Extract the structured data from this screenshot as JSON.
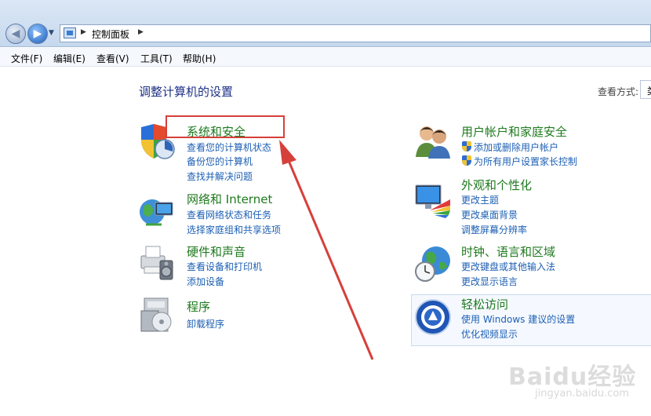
{
  "address_bar": {
    "breadcrumb": "控制面板",
    "icon": "control-panel-icon"
  },
  "menu": [
    "文件(F)",
    "编辑(E)",
    "查看(V)",
    "工具(T)",
    "帮助(H)"
  ],
  "page_title": "调整计算机的设置",
  "view_by": {
    "label": "查看方式:",
    "value": "类"
  },
  "categories": [
    {
      "title": "系统和安全",
      "icon": "security-shield-icon",
      "links": [
        "查看您的计算机状态",
        "备份您的计算机",
        "查找并解决问题"
      ]
    },
    {
      "title": "网络和 Internet",
      "icon": "network-globe-icon",
      "links": [
        "查看网络状态和任务",
        "选择家庭组和共享选项"
      ]
    },
    {
      "title": "硬件和声音",
      "icon": "printer-speaker-icon",
      "links": [
        "查看设备和打印机",
        "添加设备"
      ]
    },
    {
      "title": "程序",
      "icon": "programs-icon",
      "links": [
        "卸载程序"
      ]
    },
    {
      "title": "用户帐户和家庭安全",
      "icon": "users-icon",
      "links": [
        "添加或删除用户帐户",
        "为所有用户设置家长控制"
      ]
    },
    {
      "title": "外观和个性化",
      "icon": "appearance-monitor-icon",
      "links": [
        "更改主题",
        "更改桌面背景",
        "调整屏幕分辨率"
      ]
    },
    {
      "title": "时钟、语言和区域",
      "icon": "clock-globe-icon",
      "links": [
        "更改键盘或其他输入法",
        "更改显示语言"
      ]
    },
    {
      "title": "轻松访问",
      "icon": "ease-of-access-icon",
      "links": [
        "使用 Windows 建议的设置",
        "优化视频显示"
      ]
    }
  ],
  "annotation": {
    "box_color": "#d6403b",
    "arrow_color": "#d6403b"
  },
  "watermark": {
    "brand": "Baidu经验",
    "url": "jingyan.baidu.com"
  }
}
